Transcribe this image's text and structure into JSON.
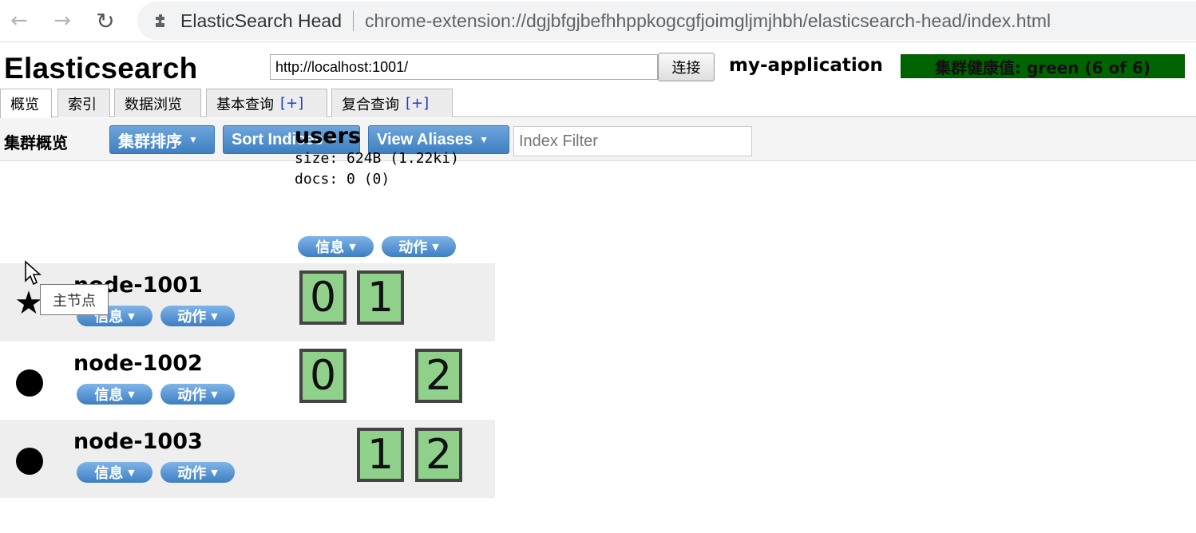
{
  "browser": {
    "extension_name": "ElasticSearch Head",
    "url": "chrome-extension://dgjbfgjbefhhppkogcgfjoimgljmjhbh/elasticsearch-head/index.html"
  },
  "header": {
    "title": "Elasticsearch",
    "connection_url": "http://localhost:1001/",
    "connect_label": "连接",
    "cluster_name": "my-application",
    "health_text": "集群健康值: green (6 of 6)",
    "health_color": "#006400"
  },
  "tabs": [
    {
      "label": "概览",
      "plus": ""
    },
    {
      "label": "索引",
      "plus": ""
    },
    {
      "label": "数据浏览",
      "plus": ""
    },
    {
      "label": "基本查询",
      "plus": "[+]"
    },
    {
      "label": "复合查询",
      "plus": "[+]"
    }
  ],
  "toolbar": {
    "title": "集群概览",
    "sort_cluster_label": "集群排序",
    "sort_indices_label": "Sort Indices",
    "view_aliases_label": "View Aliases",
    "index_filter_placeholder": "Index Filter"
  },
  "index": {
    "name": "users",
    "size": "size: 624B (1.22ki)",
    "docs": "docs: 0 (0)",
    "info_label": "信息",
    "action_label": "动作"
  },
  "nodes": [
    {
      "name": "node-1001",
      "info_label": "信息",
      "action_label": "动作",
      "master": true,
      "shards": [
        "0",
        "1"
      ]
    },
    {
      "name": "node-1002",
      "info_label": "信息",
      "action_label": "动作",
      "master": false,
      "shards": [
        "0",
        "2"
      ]
    },
    {
      "name": "node-1003",
      "info_label": "信息",
      "action_label": "动作",
      "master": false,
      "shards": [
        "1",
        "2"
      ]
    }
  ],
  "tooltip": "主节点",
  "colors": {
    "shard_fill": "#8fd18a",
    "button_blue": "#3e7fc1",
    "row_shade": "#eeeeee"
  }
}
